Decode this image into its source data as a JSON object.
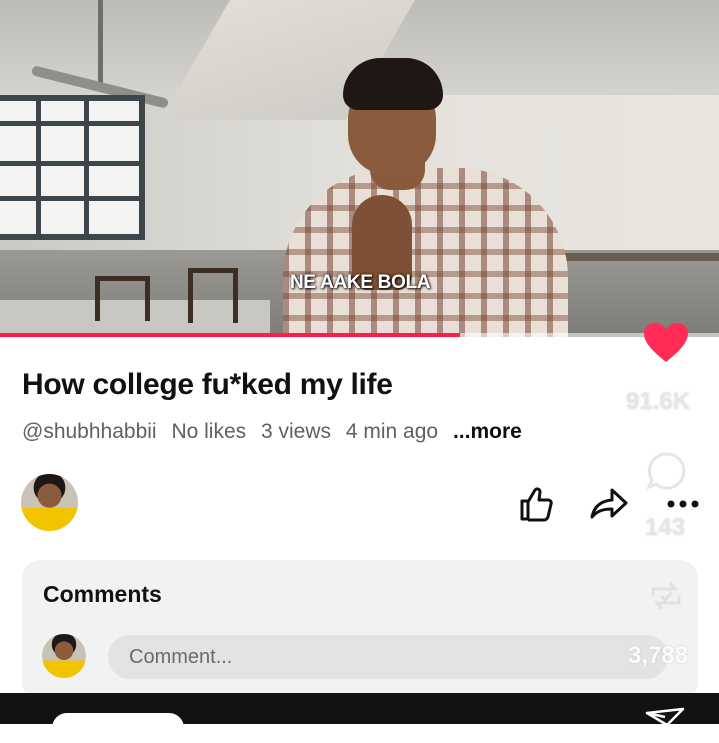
{
  "video": {
    "caption": "NE AAKE BOLA",
    "progress": 0.64
  },
  "post": {
    "title": "How college fu*ked my life",
    "handle": "@shubhhabbii",
    "likes": "No likes",
    "views": "3 views",
    "time": "4 min ago",
    "more": "...more"
  },
  "overlay": {
    "like_count": "91.6K",
    "comment_count": "143",
    "remix_count": "3,788"
  },
  "comments": {
    "title": "Comments",
    "placeholder": "Comment..."
  },
  "colors": {
    "accent": "#ff2d55",
    "progress": "#ff1e4a"
  },
  "icons": [
    "heart-icon",
    "thumbs-up-icon",
    "share-icon",
    "more-icon",
    "comment-icon",
    "remix-icon",
    "send-icon"
  ]
}
